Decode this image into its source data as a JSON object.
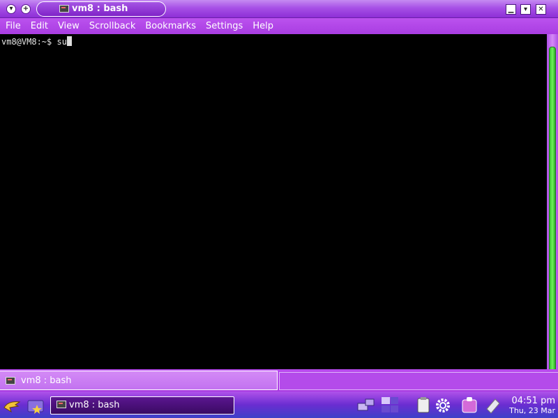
{
  "window": {
    "title": "vm8 : bash",
    "menu_button_glyph": "▾",
    "sticky_button_glyph": "+",
    "minimize_glyph": "▁",
    "maximize_glyph": "▾",
    "close_glyph": "✕"
  },
  "menubar": {
    "items": [
      "File",
      "Edit",
      "View",
      "Scrollback",
      "Bookmarks",
      "Settings",
      "Help"
    ]
  },
  "terminal": {
    "prompt": "vm8@VM8:~$ ",
    "command": "su"
  },
  "tabs": [
    {
      "label": "vm8 : bash",
      "icon": "terminal-icon"
    }
  ],
  "taskbar": {
    "window_label": "vm8 : bash",
    "clock_time": "04:51 pm",
    "clock_date": "Thu, 23 Mar"
  },
  "colors": {
    "accent_purple": "#a93de2",
    "scroll_thumb_green": "#4cd63c",
    "taskbar_blue": "#3d40c8"
  }
}
